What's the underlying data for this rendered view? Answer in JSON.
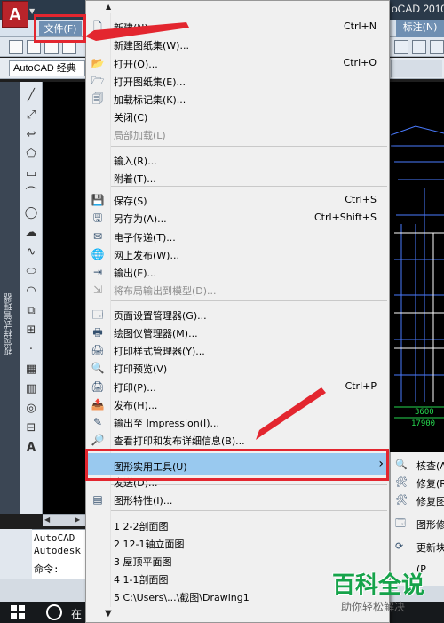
{
  "app": {
    "title": "oCAD 2010",
    "logo": "A",
    "workspace": "AutoCAD 经典"
  },
  "menubar": {
    "file": "文件(F)",
    "dimension": "标注(N)"
  },
  "side_palette": {
    "title": "视觉样式管理器"
  },
  "drawing": {
    "dim_a": "3600",
    "dim_b": "17900"
  },
  "command": {
    "line1": "AutoCAD",
    "line2": "Autodesk",
    "prompt": "命令:"
  },
  "taskbar": {
    "search": "在"
  },
  "file_menu": {
    "items": [
      {
        "label": "新建(N)...",
        "shortcut": "Ctrl+N",
        "icon": "new-file-icon"
      },
      {
        "label": "新建图纸集(W)...",
        "shortcut": "",
        "icon": ""
      },
      {
        "label": "打开(O)...",
        "shortcut": "Ctrl+O",
        "icon": "open-folder-icon"
      },
      {
        "label": "打开图纸集(E)...",
        "shortcut": "",
        "icon": "open-sheet-set-icon"
      },
      {
        "label": "加载标记集(K)...",
        "shortcut": "",
        "icon": "markup-set-icon"
      },
      {
        "label": "关闭(C)",
        "shortcut": "",
        "icon": ""
      },
      {
        "label": "局部加载(L)",
        "shortcut": "",
        "icon": "",
        "disabled": true
      },
      {
        "label": "输入(R)...",
        "shortcut": "",
        "icon": ""
      },
      {
        "label": "附着(T)...",
        "shortcut": "",
        "icon": ""
      },
      {
        "label": "保存(S)",
        "shortcut": "Ctrl+S",
        "icon": "save-icon"
      },
      {
        "label": "另存为(A)...",
        "shortcut": "Ctrl+Shift+S",
        "icon": "save-as-icon"
      },
      {
        "label": "电子传递(T)...",
        "shortcut": "",
        "icon": "etransmit-icon"
      },
      {
        "label": "网上发布(W)...",
        "shortcut": "",
        "icon": "publish-web-icon"
      },
      {
        "label": "输出(E)...",
        "shortcut": "",
        "icon": "export-icon"
      },
      {
        "label": "将布局输出到模型(D)...",
        "shortcut": "",
        "icon": "export-layout-icon",
        "disabled": true
      },
      {
        "label": "页面设置管理器(G)...",
        "shortcut": "",
        "icon": "page-setup-icon"
      },
      {
        "label": "绘图仪管理器(M)...",
        "shortcut": "",
        "icon": "plotter-manager-icon"
      },
      {
        "label": "打印样式管理器(Y)...",
        "shortcut": "",
        "icon": "plot-style-icon"
      },
      {
        "label": "打印预览(V)",
        "shortcut": "",
        "icon": "print-preview-icon"
      },
      {
        "label": "打印(P)...",
        "shortcut": "Ctrl+P",
        "icon": "print-icon"
      },
      {
        "label": "发布(H)...",
        "shortcut": "",
        "icon": "publish-icon"
      },
      {
        "label": "输出至 Impression(I)...",
        "shortcut": "",
        "icon": "impression-icon"
      },
      {
        "label": "查看打印和发布详细信息(B)...",
        "shortcut": "",
        "icon": "plot-details-icon"
      },
      {
        "label": "图形实用工具(U)",
        "shortcut": "",
        "icon": "",
        "submenu": true
      },
      {
        "label": "发送(D)...",
        "shortcut": "",
        "icon": ""
      },
      {
        "label": "图形特性(I)...",
        "shortcut": "",
        "icon": "drawing-properties-icon"
      },
      {
        "label": "1 2-2剖面图",
        "shortcut": "",
        "icon": ""
      },
      {
        "label": "2 12-1轴立面图",
        "shortcut": "",
        "icon": ""
      },
      {
        "label": "3 屋顶平面图",
        "shortcut": "",
        "icon": ""
      },
      {
        "label": "4 1-1剖面图",
        "shortcut": "",
        "icon": ""
      },
      {
        "label": "5 C:\\Users\\...\\截图\\Drawing1",
        "shortcut": "",
        "icon": ""
      }
    ]
  },
  "submenu": {
    "items": [
      {
        "label": "核查(A",
        "icon": "audit-icon"
      },
      {
        "label": "修复(R",
        "icon": "recover-icon"
      },
      {
        "label": "修复图",
        "icon": "recover-xref-icon"
      },
      {
        "label": "图形修",
        "icon": "drawing-recovery-icon"
      },
      {
        "label": "更新块",
        "icon": "update-block-icon"
      },
      {
        "label": "(P",
        "icon": ""
      }
    ]
  },
  "watermark": {
    "title": "百科全说",
    "subtitle": "助你轻松解决"
  },
  "colors": {
    "highlight": "#99c9ef",
    "annotation": "#e3262f",
    "menu_bg": "#f0f0f0",
    "watermark": "#16a34a"
  }
}
